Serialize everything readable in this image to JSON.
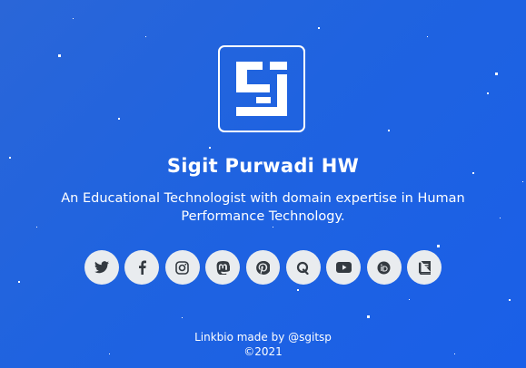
{
  "profile": {
    "name": "Sigit Purwadi HW",
    "bio": "An Educational Technologist with domain expertise in Human Performance Technology."
  },
  "socials": [
    {
      "icon": "twitter-icon",
      "label": "Twitter"
    },
    {
      "icon": "facebook-icon",
      "label": "Facebook"
    },
    {
      "icon": "instagram-icon",
      "label": "Instagram"
    },
    {
      "icon": "mastodon-icon",
      "label": "Mastodon"
    },
    {
      "icon": "pinterest-icon",
      "label": "Pinterest"
    },
    {
      "icon": "quora-icon",
      "label": "Quora"
    },
    {
      "icon": "youtube-icon",
      "label": "YouTube"
    },
    {
      "icon": "orcid-icon",
      "label": "ORCID"
    },
    {
      "icon": "book-icon",
      "label": "Book"
    }
  ],
  "footer": {
    "credit": "Linkbio made by @sgitsp",
    "copyright": "©2021"
  },
  "colors": {
    "background": "#1f63e0",
    "icon_circle": "#e9ecef",
    "icon_glyph": "#343a40",
    "text": "#ffffff"
  }
}
